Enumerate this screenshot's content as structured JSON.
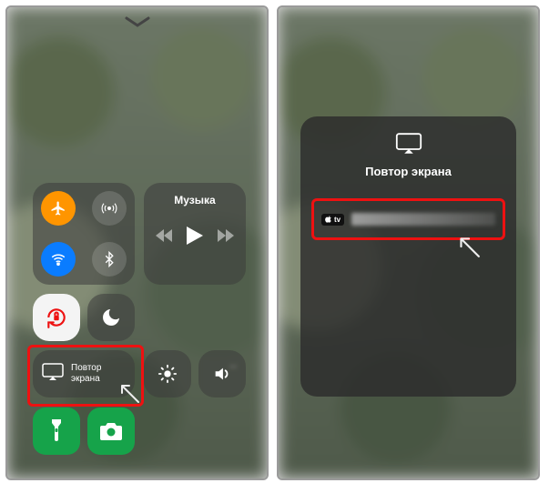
{
  "left": {
    "music_label": "Музыка",
    "mirror_label": "Повтор экрана"
  },
  "right": {
    "panel_title": "Повтор экрана",
    "device_badge": "tv"
  }
}
